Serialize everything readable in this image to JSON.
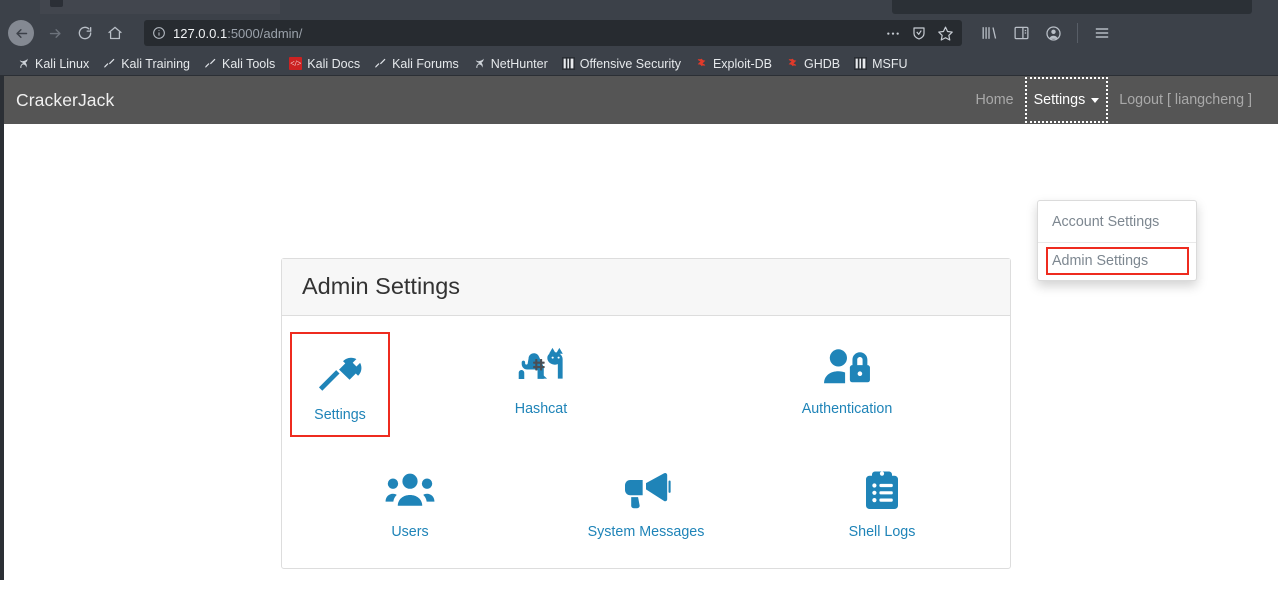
{
  "browser": {
    "url_host": "127.0.0.1",
    "url_rest": ":5000/admin/",
    "url_full": "127.0.0.1:5000/admin/",
    "icons": {
      "back": "back-arrow-icon",
      "forward": "forward-arrow-icon",
      "reload": "reload-icon",
      "home": "home-icon",
      "identity": "page-info-icon",
      "more": "ellipsis-icon",
      "shield": "tracking-protection-icon",
      "bookmark": "bookmark-star-icon",
      "library": "library-icon",
      "sidebar": "sidebar-icon",
      "account": "account-icon",
      "menu": "hamburger-menu-icon"
    },
    "bookmarks": [
      {
        "label": "Kali Linux",
        "icon": "kali-dragon-icon"
      },
      {
        "label": "Kali Training",
        "icon": "kali-tool-icon"
      },
      {
        "label": "Kali Tools",
        "icon": "kali-tool-icon"
      },
      {
        "label": "Kali Docs",
        "icon": "kali-docs-icon"
      },
      {
        "label": "Kali Forums",
        "icon": "kali-tool-icon"
      },
      {
        "label": "NetHunter",
        "icon": "kali-dragon-icon"
      },
      {
        "label": "Offensive Security",
        "icon": "msf-icon"
      },
      {
        "label": "Exploit-DB",
        "icon": "exploit-db-icon"
      },
      {
        "label": "GHDB",
        "icon": "exploit-db-icon"
      },
      {
        "label": "MSFU",
        "icon": "msf-icon"
      }
    ]
  },
  "app": {
    "brand": "CrackerJack",
    "navbar": {
      "home_label": "Home",
      "settings_label": "Settings",
      "logout_label": "Logout [ liangcheng ]",
      "username": "liangcheng"
    },
    "dropdown": {
      "items": [
        {
          "label": "Account Settings",
          "highlighted": false
        },
        {
          "label": "Admin Settings",
          "highlighted": true
        }
      ]
    },
    "card": {
      "title": "Admin Settings",
      "tiles_row1": [
        {
          "label": "Settings",
          "icon": "hammer-icon",
          "highlighted": true
        },
        {
          "label": "Hashcat",
          "icon": "cat-hash-icon",
          "highlighted": false
        },
        {
          "label": "Authentication",
          "icon": "user-lock-icon",
          "highlighted": false
        }
      ],
      "tiles_row2": [
        {
          "label": "Users",
          "icon": "users-icon",
          "highlighted": false
        },
        {
          "label": "System Messages",
          "icon": "bullhorn-icon",
          "highlighted": false
        },
        {
          "label": "Shell Logs",
          "icon": "clipboard-list-icon",
          "highlighted": false
        }
      ]
    }
  },
  "colors": {
    "navbar_bg": "#555555",
    "icon_accent": "#1f84b8",
    "link": "#1f84b8",
    "highlight_box": "#ee2b1f",
    "card_header_bg": "#f7f7f7",
    "chrome_bg": "#3c4149"
  }
}
